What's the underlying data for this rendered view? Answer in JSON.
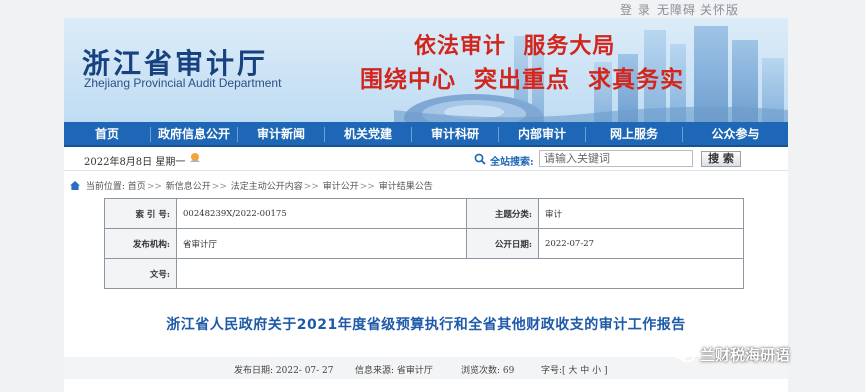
{
  "top_links": [
    "登 录",
    "无障碍",
    "关怀版"
  ],
  "banner": {
    "title_cn": "浙江省审计厅",
    "title_en": "Zhejiang Provincial Audit Department",
    "slogan_line1": "依法审计  服务大局",
    "slogan_line2": "围绕中心  突出重点  求真务实"
  },
  "nav": [
    "首页",
    "政府信息公开",
    "审计新闻",
    "机关党建",
    "审计科研",
    "内部审计",
    "网上服务",
    "公众参与"
  ],
  "infobar": {
    "date": "2022年8月8日 星期一",
    "search_label": "全站搜索:",
    "search_placeholder": "请输入关键词",
    "search_button": "搜 索"
  },
  "breadcrumb": {
    "prefix": "当前位置:",
    "items": [
      "首页",
      "新信息公开",
      "法定主动公开内容",
      "审计公开",
      "审计结果公告"
    ],
    "separator": ">>"
  },
  "meta": {
    "index_label": "索 引 号:",
    "index_value": "00248239X/2022-00175",
    "category_label": "主题分类:",
    "category_value": "审计",
    "issuer_label": "发布机构:",
    "issuer_value": "省审计厅",
    "published_label": "公开日期:",
    "published_value": "2022-07-27",
    "docno_label": "文号:",
    "docno_value": ""
  },
  "document": {
    "title": "浙江省人民政府关于2021年度省级预算执行和全省其他财政收支的审计工作报告"
  },
  "pubinfo": {
    "date": "发布日期: 2022- 07- 27",
    "source": "信息来源: 省审计厅",
    "views": "浏览次数: 69",
    "fontsize": "字号:[ 大 中 小 ]"
  },
  "watermark": "兰财税海研语",
  "colors": {
    "nav_bg": "#1d67b6",
    "title_blue": "#1e5aa8",
    "slogan_red": "#d2251c"
  }
}
